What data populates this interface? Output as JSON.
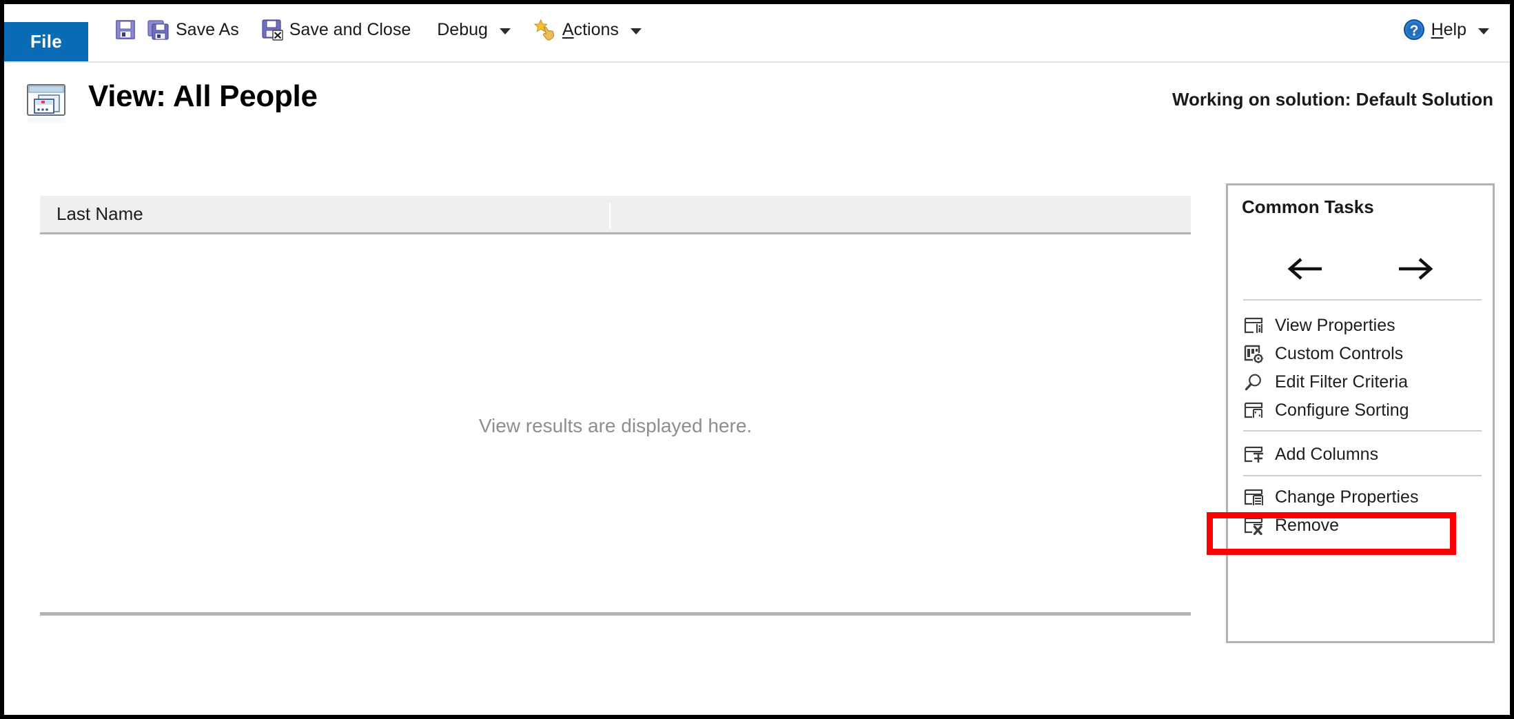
{
  "window": {
    "file_tab_label": "File"
  },
  "toolbar": {
    "items": [
      {
        "id": "save",
        "label": "",
        "icon": "save-floppy-icon",
        "has_caret": false
      },
      {
        "id": "save-as",
        "label": "Save As",
        "icon": "save-as-floppy-icon",
        "has_caret": false
      },
      {
        "id": "save-and-close",
        "label": "Save and Close",
        "icon": "save-and-close-floppy-icon",
        "has_caret": false
      },
      {
        "id": "debug",
        "label": "Debug",
        "icon": "",
        "has_caret": true
      },
      {
        "id": "actions",
        "label": "Actions",
        "icon": "actions-star-hand-icon",
        "has_caret": true
      }
    ],
    "help": {
      "label": "Help",
      "icon": "help-question-circle-icon",
      "has_caret": true
    }
  },
  "header": {
    "icon": "view-form-window-icon",
    "title": "View: All People",
    "solution_note": "Working on solution: Default Solution"
  },
  "grid": {
    "columns": [
      "Last Name",
      ""
    ],
    "rows": [],
    "empty_message": "View results are displayed here."
  },
  "common_tasks": {
    "title": "Common Tasks",
    "nav": {
      "back_icon": "arrow-left-icon",
      "forward_icon": "arrow-right-icon"
    },
    "groups": [
      {
        "items": [
          {
            "id": "view-properties",
            "label": "View Properties",
            "icon": "view-properties-icon"
          },
          {
            "id": "custom-controls",
            "label": "Custom Controls",
            "icon": "custom-controls-icon"
          },
          {
            "id": "edit-filter-criteria",
            "label": "Edit Filter Criteria",
            "icon": "magnifier-icon"
          },
          {
            "id": "configure-sorting",
            "label": "Configure Sorting",
            "icon": "configure-sorting-icon"
          }
        ]
      },
      {
        "items": [
          {
            "id": "add-columns",
            "label": "Add Columns",
            "icon": "add-columns-icon"
          }
        ]
      },
      {
        "items": [
          {
            "id": "change-properties",
            "label": "Change Properties",
            "icon": "change-properties-icon"
          },
          {
            "id": "remove",
            "label": "Remove",
            "icon": "remove-column-icon"
          }
        ]
      }
    ],
    "highlighted_item": "add-columns"
  },
  "colors": {
    "file_tab_blue": "#0a6cb6",
    "highlight_red": "#fb0303",
    "grid_header_gray": "#efefef",
    "border_gray": "#b2b2b2",
    "placeholder_gray": "#8e8e8e"
  }
}
